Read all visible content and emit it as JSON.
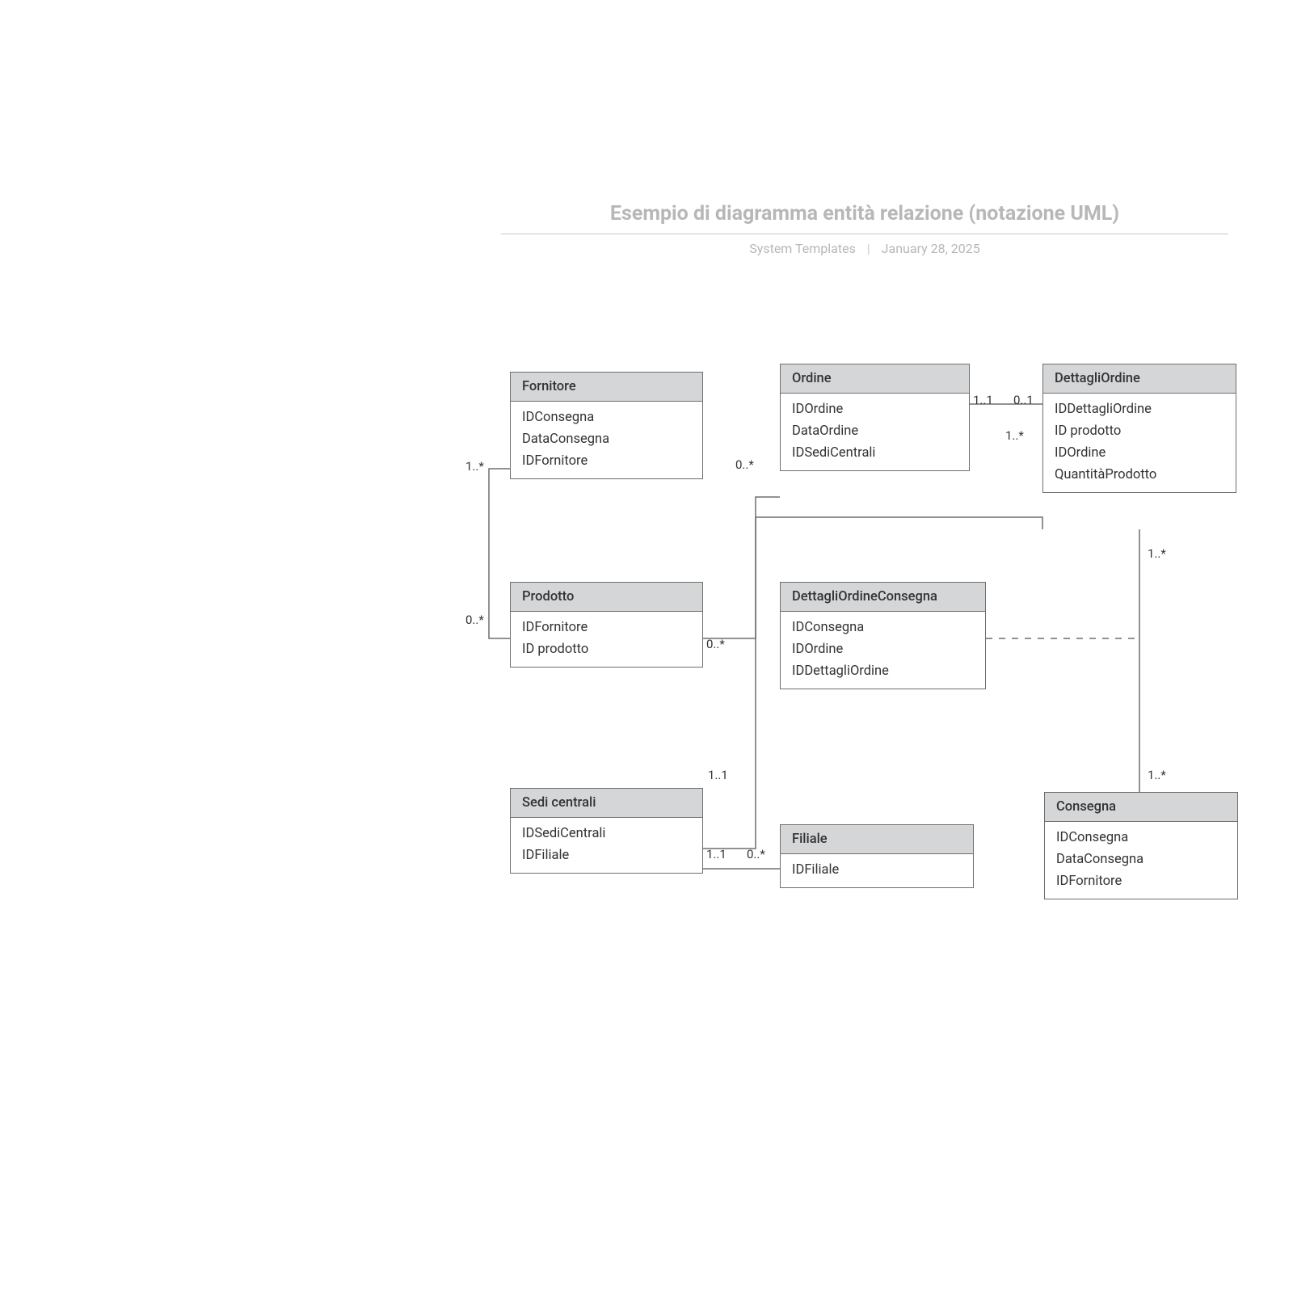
{
  "header": {
    "title": "Esempio di diagramma entità relazione (notazione UML)",
    "subtitle_left": "System Templates",
    "subtitle_right": "January 28, 2025"
  },
  "entities": {
    "fornitore": {
      "name": "Fornitore",
      "attrs": [
        "IDConsegna",
        "DataConsegna",
        "IDFornitore"
      ]
    },
    "prodotto": {
      "name": "Prodotto",
      "attrs": [
        "IDFornitore",
        "ID prodotto"
      ]
    },
    "sedi": {
      "name": "Sedi centrali",
      "attrs": [
        "IDSediCentrali",
        "IDFiliale"
      ]
    },
    "ordine": {
      "name": "Ordine",
      "attrs": [
        "IDOrdine",
        "DataOrdine",
        "IDSediCentrali"
      ]
    },
    "dettagliOrdine": {
      "name": "DettagliOrdine",
      "attrs": [
        "IDDettagliOrdine",
        "ID prodotto",
        "IDOrdine",
        "QuantitàProdotto"
      ]
    },
    "dettagliOrdineConsegna": {
      "name": "DettagliOrdineConsegna",
      "attrs": [
        "IDConsegna",
        "IDOrdine",
        "IDDettagliOrdine"
      ]
    },
    "filiale": {
      "name": "Filiale",
      "attrs": [
        "IDFiliale"
      ]
    },
    "consegna": {
      "name": "Consegna",
      "attrs": [
        "IDConsegna",
        "DataConsegna",
        "IDFornitore"
      ]
    }
  },
  "cardinalities": {
    "fornitore_prodotto_top": "1..*",
    "fornitore_prodotto_bottom": "0..*",
    "prodotto_dettagli_left": "0..*",
    "prodotto_dettagli_right": "1..*",
    "ordine_dettagli_left": "1..1",
    "ordine_dettagli_right": "0..1",
    "sedi_ordine_top": "0..*",
    "sedi_ordine_bottom": "1..1",
    "sedi_filiale_left": "1..1",
    "sedi_filiale_right": "0..*",
    "dettagli_consegna_top": "1..*",
    "dettagli_consegna_bottom": "1..*"
  }
}
